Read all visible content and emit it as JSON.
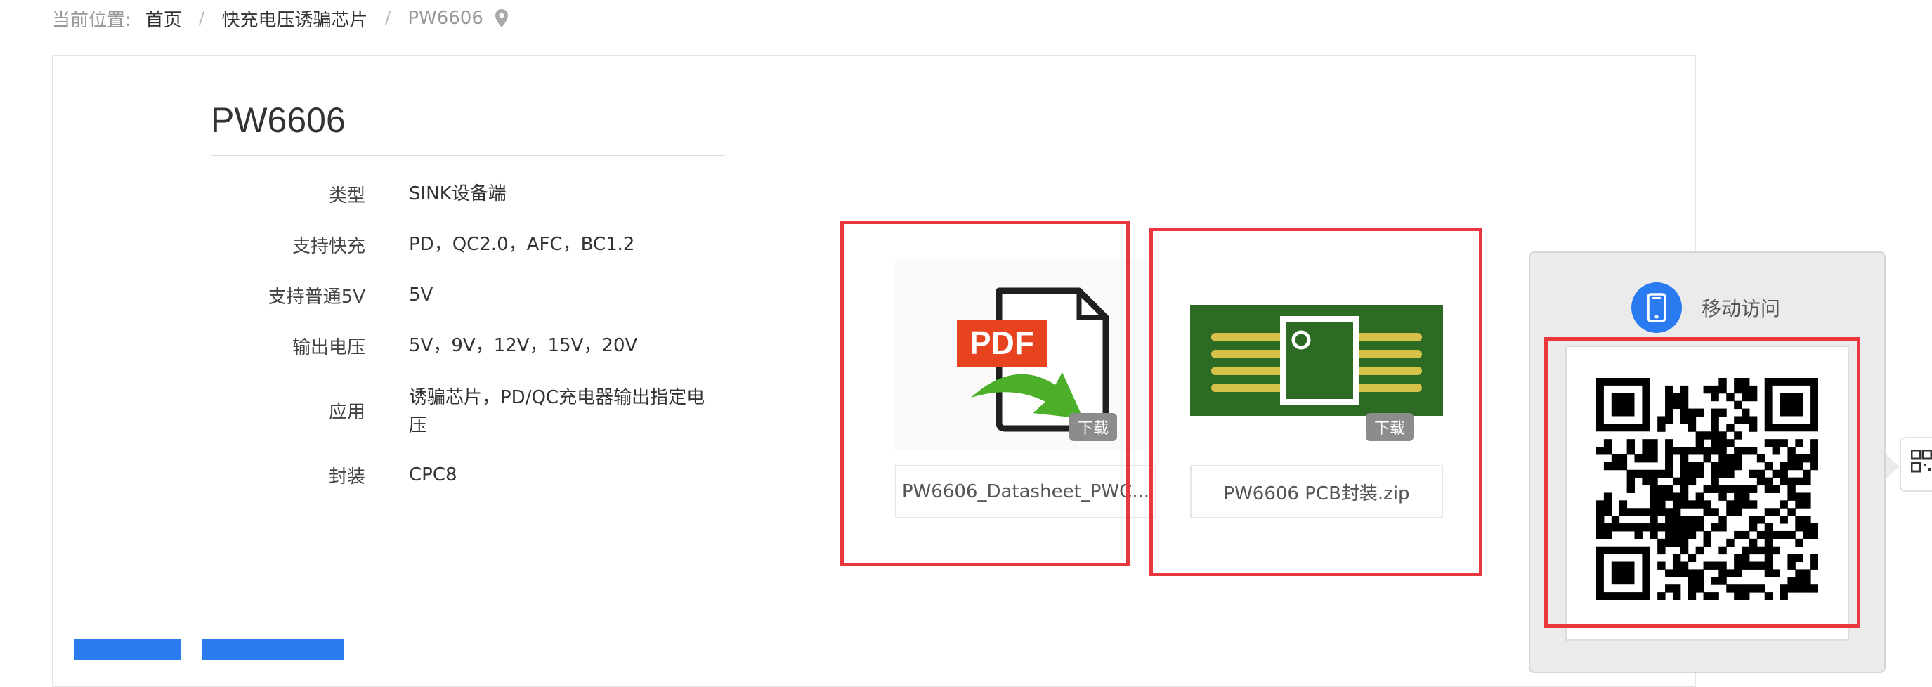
{
  "breadcrumb": {
    "label": "当前位置:",
    "home": "首页",
    "category": "快充电压诱骗芯片",
    "current": "PW6606",
    "separator": "/"
  },
  "product": {
    "title": "PW6606",
    "specs": [
      {
        "label": "类型",
        "value": "SINK设备端"
      },
      {
        "label": "支持快充",
        "value": "PD，QC2.0，AFC，BC1.2"
      },
      {
        "label": "支持普通5V",
        "value": "5V"
      },
      {
        "label": "输出电压",
        "value": "5V，9V，12V，15V，20V"
      },
      {
        "label": "应用",
        "value": "诱骗芯片，PD/QC充电器输出指定电压"
      },
      {
        "label": "封装",
        "value": "CPC8"
      }
    ]
  },
  "downloads": [
    {
      "icon": "pdf-file-icon",
      "badge": "下载",
      "filename": "PW6606_Datasheet_PWC..."
    },
    {
      "icon": "pcb-chip-icon",
      "badge": "下载",
      "filename": "PW6606 PCB封装.zip"
    }
  ],
  "mobile_panel": {
    "label": "移动访问",
    "icon": "mobile-phone-icon",
    "qr_icon": "qr-code-icon"
  },
  "colors": {
    "accent_blue": "#2b7bf0",
    "annotation_red": "#e8383d",
    "pcb_green": "#2d6a24",
    "pdf_red": "#e8431f"
  }
}
